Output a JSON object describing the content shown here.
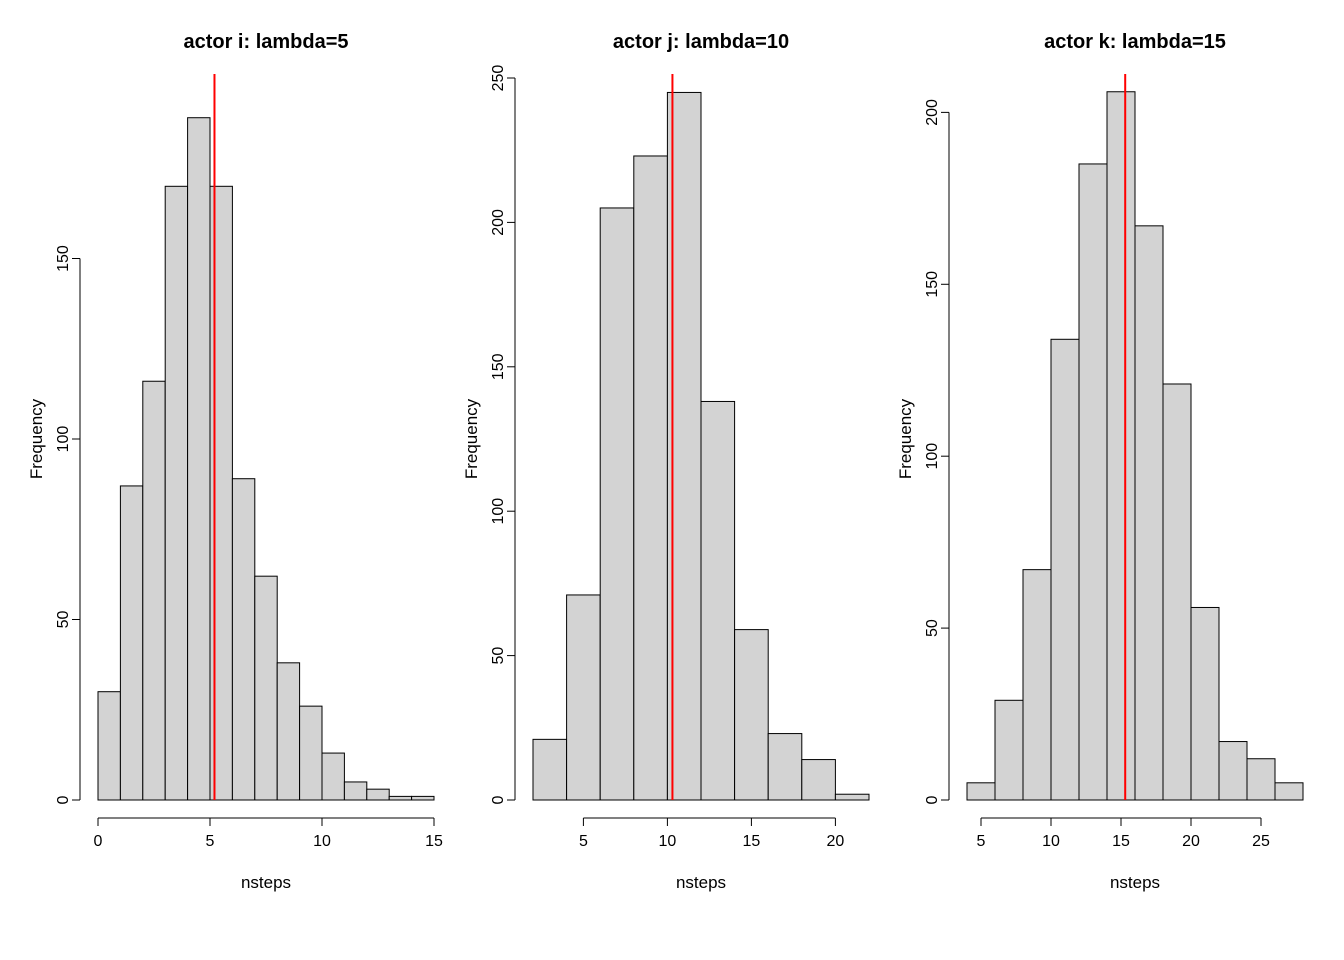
{
  "chart_data": [
    {
      "type": "bar",
      "title": "actor i: lambda=5",
      "xlabel": "nsteps",
      "ylabel": "Frequency",
      "xlim": [
        0,
        15
      ],
      "ylim": [
        0,
        200
      ],
      "xticks": [
        0,
        5,
        10,
        15
      ],
      "yticks": [
        0,
        50,
        100,
        150
      ],
      "bin_width": 1,
      "bins": [
        {
          "x0": 0,
          "x1": 1,
          "count": 30
        },
        {
          "x0": 1,
          "x1": 2,
          "count": 87
        },
        {
          "x0": 2,
          "x1": 3,
          "count": 116
        },
        {
          "x0": 3,
          "x1": 4,
          "count": 170
        },
        {
          "x0": 4,
          "x1": 5,
          "count": 189
        },
        {
          "x0": 5,
          "x1": 6,
          "count": 170
        },
        {
          "x0": 6,
          "x1": 7,
          "count": 89
        },
        {
          "x0": 7,
          "x1": 8,
          "count": 62
        },
        {
          "x0": 8,
          "x1": 9,
          "count": 38
        },
        {
          "x0": 9,
          "x1": 10,
          "count": 26
        },
        {
          "x0": 10,
          "x1": 11,
          "count": 13
        },
        {
          "x0": 11,
          "x1": 12,
          "count": 5
        },
        {
          "x0": 12,
          "x1": 13,
          "count": 3
        },
        {
          "x0": 13,
          "x1": 14,
          "count": 1
        },
        {
          "x0": 14,
          "x1": 15,
          "count": 1
        }
      ],
      "vline": 5.2,
      "vline_color": "#ff0000",
      "bar_fill": "#d3d3d3",
      "bar_stroke": "#000000"
    },
    {
      "type": "bar",
      "title": "actor j: lambda=10",
      "xlabel": "nsteps",
      "ylabel": "Frequency",
      "xlim": [
        2,
        22
      ],
      "ylim": [
        0,
        250
      ],
      "xticks": [
        5,
        10,
        15,
        20
      ],
      "yticks": [
        0,
        50,
        100,
        150,
        200,
        250
      ],
      "bin_width": 2,
      "bins": [
        {
          "x0": 2,
          "x1": 4,
          "count": 21
        },
        {
          "x0": 4,
          "x1": 6,
          "count": 71
        },
        {
          "x0": 6,
          "x1": 8,
          "count": 205
        },
        {
          "x0": 8,
          "x1": 10,
          "count": 223
        },
        {
          "x0": 10,
          "x1": 12,
          "count": 245
        },
        {
          "x0": 12,
          "x1": 14,
          "count": 138
        },
        {
          "x0": 14,
          "x1": 16,
          "count": 59
        },
        {
          "x0": 16,
          "x1": 18,
          "count": 23
        },
        {
          "x0": 18,
          "x1": 20,
          "count": 14
        },
        {
          "x0": 20,
          "x1": 22,
          "count": 2
        }
      ],
      "vline": 10.3,
      "vline_color": "#ff0000",
      "bar_fill": "#d3d3d3",
      "bar_stroke": "#000000"
    },
    {
      "type": "bar",
      "title": "actor k: lambda=15",
      "xlabel": "nsteps",
      "ylabel": "Frequency",
      "xlim": [
        4,
        28
      ],
      "ylim": [
        0,
        210
      ],
      "xticks": [
        5,
        10,
        15,
        20,
        25
      ],
      "yticks": [
        0,
        50,
        100,
        150,
        200
      ],
      "bin_width": 2,
      "bins": [
        {
          "x0": 4,
          "x1": 6,
          "count": 5
        },
        {
          "x0": 6,
          "x1": 8,
          "count": 29
        },
        {
          "x0": 8,
          "x1": 10,
          "count": 67
        },
        {
          "x0": 10,
          "x1": 12,
          "count": 134
        },
        {
          "x0": 12,
          "x1": 14,
          "count": 185
        },
        {
          "x0": 14,
          "x1": 16,
          "count": 206
        },
        {
          "x0": 16,
          "x1": 18,
          "count": 167
        },
        {
          "x0": 18,
          "x1": 20,
          "count": 121
        },
        {
          "x0": 20,
          "x1": 22,
          "count": 56
        },
        {
          "x0": 22,
          "x1": 24,
          "count": 17
        },
        {
          "x0": 24,
          "x1": 26,
          "count": 12
        },
        {
          "x0": 26,
          "x1": 28,
          "count": 5
        }
      ],
      "vline": 15.3,
      "vline_color": "#ff0000",
      "bar_fill": "#d3d3d3",
      "bar_stroke": "#000000"
    }
  ]
}
